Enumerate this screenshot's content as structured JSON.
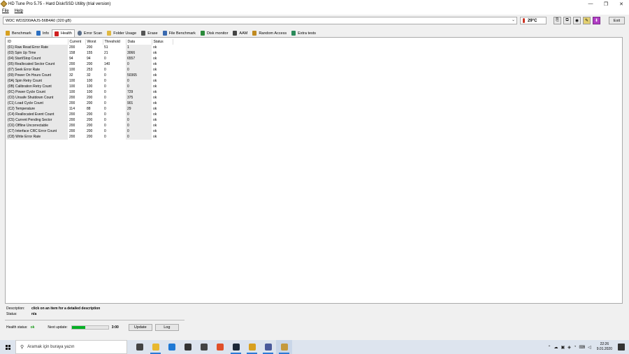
{
  "window": {
    "title": "HD Tune Pro 5.75 - Hard Disk/SSD Utility (trial version)",
    "controls": [
      "—",
      "❐",
      "✕"
    ]
  },
  "menu": [
    "File",
    "Help"
  ],
  "drive": {
    "name": "WDC WD3200AAJS-56B4A0 (320 gB)",
    "temperature": "29°C",
    "exit_label": "Exit"
  },
  "tabs": [
    {
      "label": "Benchmark",
      "icon": "benchmark-icon",
      "color": "#d7a020"
    },
    {
      "label": "Info",
      "icon": "info-icon",
      "color": "#2b6fc1"
    },
    {
      "label": "Health",
      "icon": "health-cross-icon",
      "color": "#d02020"
    },
    {
      "label": "Error Scan",
      "icon": "magnifier-icon",
      "color": "#5b6f8a"
    },
    {
      "label": "Folder Usage",
      "icon": "folder-icon",
      "color": "#e0b840"
    },
    {
      "label": "Erase",
      "icon": "erase-icon",
      "color": "#555"
    },
    {
      "label": "File Benchmark",
      "icon": "file-benchmark-icon",
      "color": "#3a6ab0"
    },
    {
      "label": "Disk monitor",
      "icon": "disk-monitor-icon",
      "color": "#2a8a3a"
    },
    {
      "label": "AAM",
      "icon": "speaker-icon",
      "color": "#444"
    },
    {
      "label": "Random Access",
      "icon": "random-access-icon",
      "color": "#c08a20"
    },
    {
      "label": "Extra tests",
      "icon": "extra-tests-icon",
      "color": "#2a8a5a"
    }
  ],
  "table": {
    "headers": [
      "ID",
      "Current",
      "Worst",
      "Threshold",
      "Data",
      "Status"
    ],
    "rows": [
      [
        "(01) Raw Read Error Rate",
        "200",
        "200",
        "51",
        "1",
        "ok"
      ],
      [
        "(03) Spin Up Time",
        "158",
        "155",
        "21",
        "3066",
        "ok"
      ],
      [
        "(04) Start/Stop Count",
        "94",
        "94",
        "0",
        "6557",
        "ok"
      ],
      [
        "(05) Reallocated Sector Count",
        "200",
        "200",
        "140",
        "0",
        "ok"
      ],
      [
        "(07) Seek Error Rate",
        "100",
        "253",
        "0",
        "0",
        "ok"
      ],
      [
        "(09) Power On Hours Count",
        "32",
        "32",
        "0",
        "50365",
        "ok"
      ],
      [
        "(0A) Spin Retry Count",
        "100",
        "100",
        "0",
        "0",
        "ok"
      ],
      [
        "(0B) Calibration Retry Count",
        "100",
        "100",
        "0",
        "0",
        "ok"
      ],
      [
        "(0C) Power Cycle Count",
        "100",
        "100",
        "0",
        "729",
        "ok"
      ],
      [
        "(C0) Unsafe Shutdown Count",
        "200",
        "200",
        "0",
        "375",
        "ok"
      ],
      [
        "(C1) Load Cycle Count",
        "200",
        "200",
        "0",
        "901",
        "ok"
      ],
      [
        "(C2) Temperature",
        "114",
        "88",
        "0",
        "29",
        "ok"
      ],
      [
        "(C4) Reallocated Event Count",
        "200",
        "200",
        "0",
        "0",
        "ok"
      ],
      [
        "(C5) Current Pending Sector",
        "200",
        "200",
        "0",
        "0",
        "ok"
      ],
      [
        "(C6) Offline Uncorrectable",
        "200",
        "200",
        "0",
        "0",
        "ok"
      ],
      [
        "(C7) Interface CRC Error Count",
        "200",
        "200",
        "0",
        "0",
        "ok"
      ],
      [
        "(C8) Write Error Rate",
        "200",
        "200",
        "0",
        "0",
        "ok"
      ]
    ]
  },
  "description": {
    "label": "Description:",
    "value": "click on an item for a detailed description",
    "status_label": "Status:",
    "status_value": "n/a"
  },
  "health": {
    "label": "Health status:",
    "value": "ok",
    "next_label": "Next update:",
    "progress": 0.37,
    "time": "3:00",
    "update_label": "Update",
    "log_label": "Log",
    "ok_color": "#1a9a1a"
  },
  "taskbar": {
    "search_placeholder": "Aramak için buraya yazın",
    "apps": [
      {
        "name": "task-view-icon",
        "color": "#444",
        "running": false
      },
      {
        "name": "file-explorer-icon",
        "color": "#e8b830",
        "running": true
      },
      {
        "name": "edge-icon",
        "color": "#1e78d4",
        "running": false
      },
      {
        "name": "store-icon",
        "color": "#333",
        "running": false
      },
      {
        "name": "mail-icon",
        "color": "#444",
        "running": false
      },
      {
        "name": "app-orange-icon",
        "color": "#e0502a",
        "running": false
      },
      {
        "name": "steam-icon",
        "color": "#1b2838",
        "running": true
      },
      {
        "name": "chrome-icon",
        "color": "#d8a020",
        "running": true
      },
      {
        "name": "remote-app-icon",
        "color": "#4a5a9a",
        "running": true
      },
      {
        "name": "hdtune-icon",
        "color": "#c59a3c",
        "running": true
      }
    ],
    "time": "22:26",
    "date": "9.01.2020"
  }
}
